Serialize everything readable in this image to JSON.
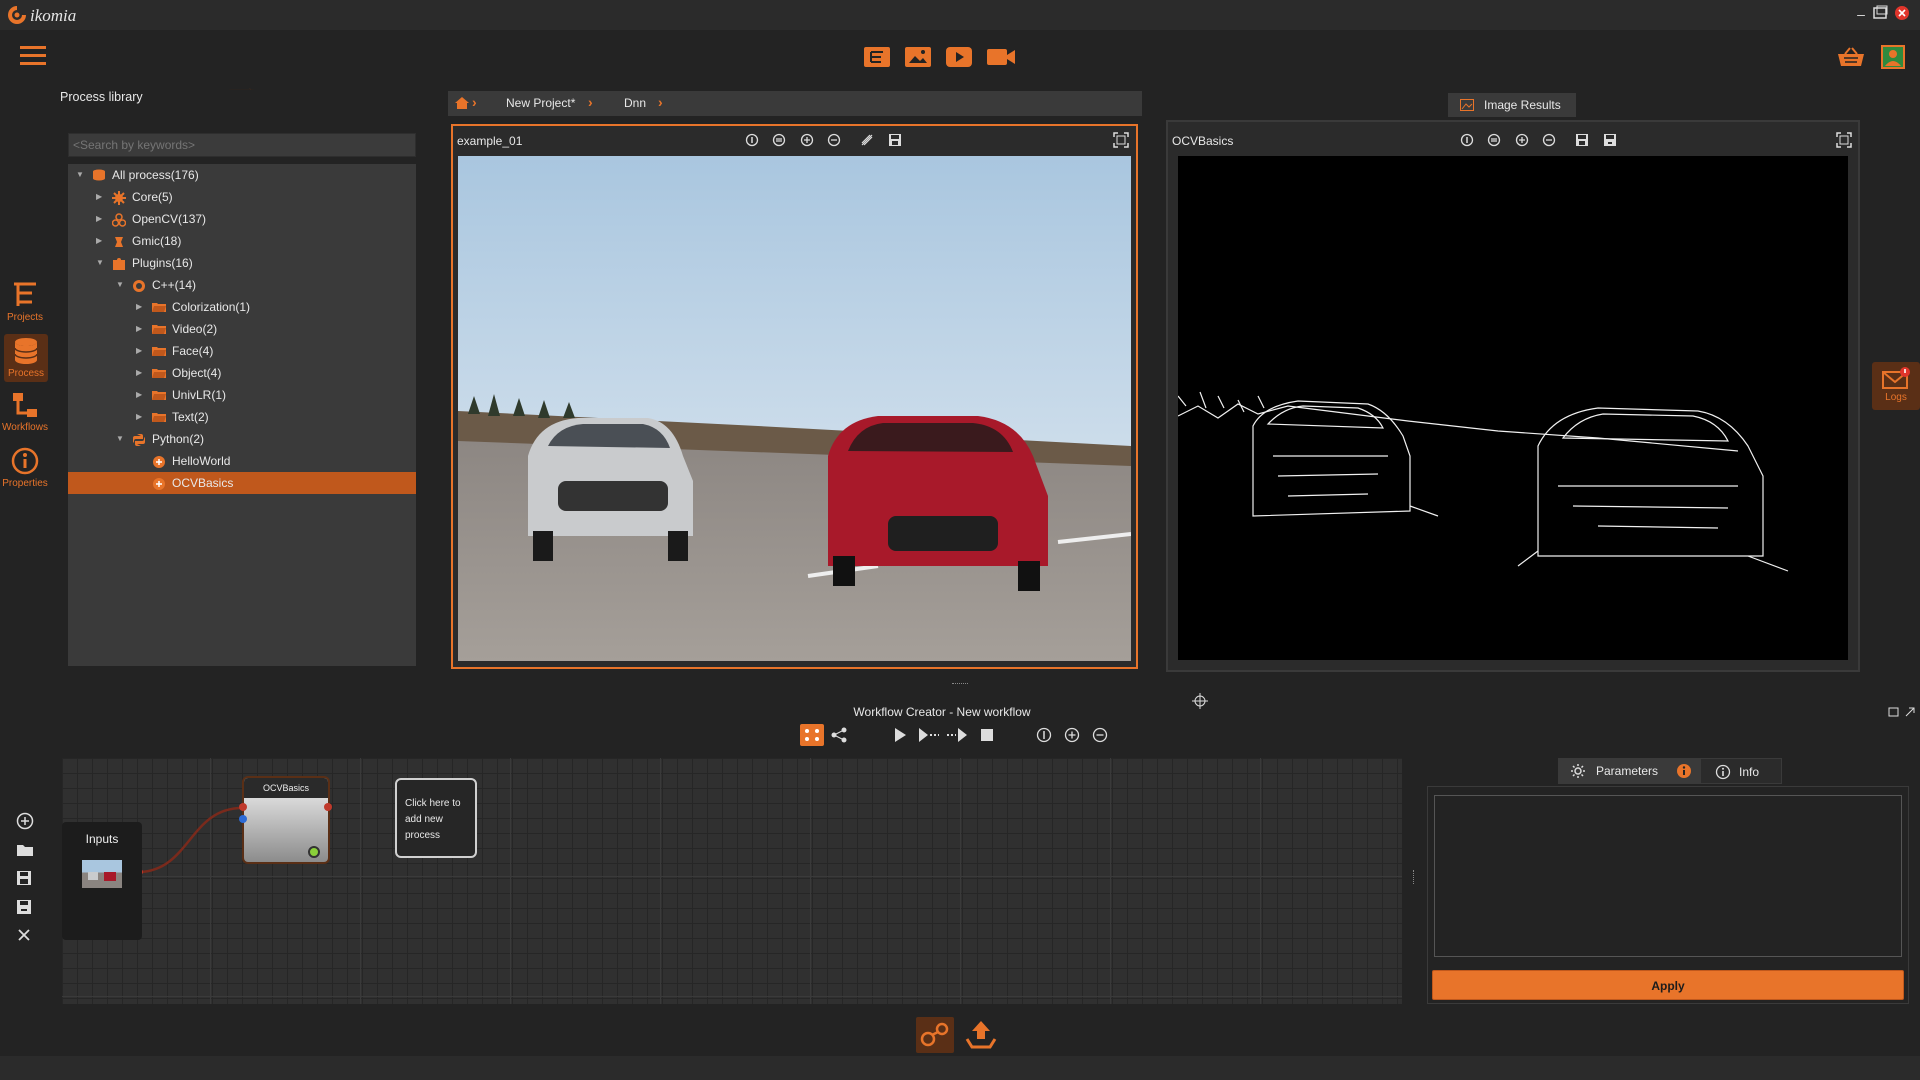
{
  "app": {
    "name": "ikomia"
  },
  "toolbar": {
    "icons": [
      "project-icon",
      "image-icon",
      "play-icon",
      "video-camera-icon"
    ],
    "right_icons": [
      "store-icon",
      "user-icon"
    ]
  },
  "nav": {
    "projects": "Projects",
    "process": "Process",
    "workflows": "Workflows",
    "properties": "Properties"
  },
  "library": {
    "tab_label": "Process library",
    "search_placeholder": "<Search by keywords>",
    "tree": [
      {
        "label": "All process(176)",
        "level": 0,
        "expanded": true,
        "icon": "database-icon"
      },
      {
        "label": "Core(5)",
        "level": 1,
        "expanded": false,
        "icon": "gear-icon"
      },
      {
        "label": "OpenCV(137)",
        "level": 1,
        "expanded": false,
        "icon": "opencv-icon"
      },
      {
        "label": "Gmic(18)",
        "level": 1,
        "expanded": false,
        "icon": "gmic-icon"
      },
      {
        "label": "Plugins(16)",
        "level": 1,
        "expanded": true,
        "icon": "puzzle-icon"
      },
      {
        "label": "C++(14)",
        "level": 2,
        "expanded": true,
        "icon": "cpp-icon"
      },
      {
        "label": "Colorization(1)",
        "level": 3,
        "expanded": false,
        "icon": "folder-icon"
      },
      {
        "label": "Video(2)",
        "level": 3,
        "expanded": false,
        "icon": "folder-icon"
      },
      {
        "label": "Face(4)",
        "level": 3,
        "expanded": false,
        "icon": "folder-icon"
      },
      {
        "label": "Object(4)",
        "level": 3,
        "expanded": false,
        "icon": "folder-icon"
      },
      {
        "label": "UnivLR(1)",
        "level": 3,
        "expanded": false,
        "icon": "folder-icon"
      },
      {
        "label": "Text(2)",
        "level": 3,
        "expanded": false,
        "icon": "folder-icon"
      },
      {
        "label": "Python(2)",
        "level": 2,
        "expanded": true,
        "icon": "python-icon"
      },
      {
        "label": "HelloWorld",
        "level": 3,
        "leaf": true,
        "icon": "plugin-icon"
      },
      {
        "label": "OCVBasics",
        "level": 3,
        "leaf": true,
        "icon": "plugin-icon",
        "selected": true
      }
    ]
  },
  "breadcrumb": {
    "items": [
      "New Project*",
      "Dnn"
    ]
  },
  "viewer1": {
    "title": "example_01"
  },
  "viewer2": {
    "title": "OCVBasics",
    "tab_label": "Image Results"
  },
  "side": {
    "logs": "Logs"
  },
  "workflow": {
    "title": "Workflow Creator - New workflow",
    "inputs_label": "Inputs",
    "node_label": "OCVBasics",
    "add_process_text": "Click here to add new process"
  },
  "params": {
    "parameters_tab": "Parameters",
    "info_tab": "Info",
    "apply_label": "Apply"
  },
  "colors": {
    "accent": "#e8742a",
    "panel": "#3a3a3a",
    "background": "#232323"
  }
}
